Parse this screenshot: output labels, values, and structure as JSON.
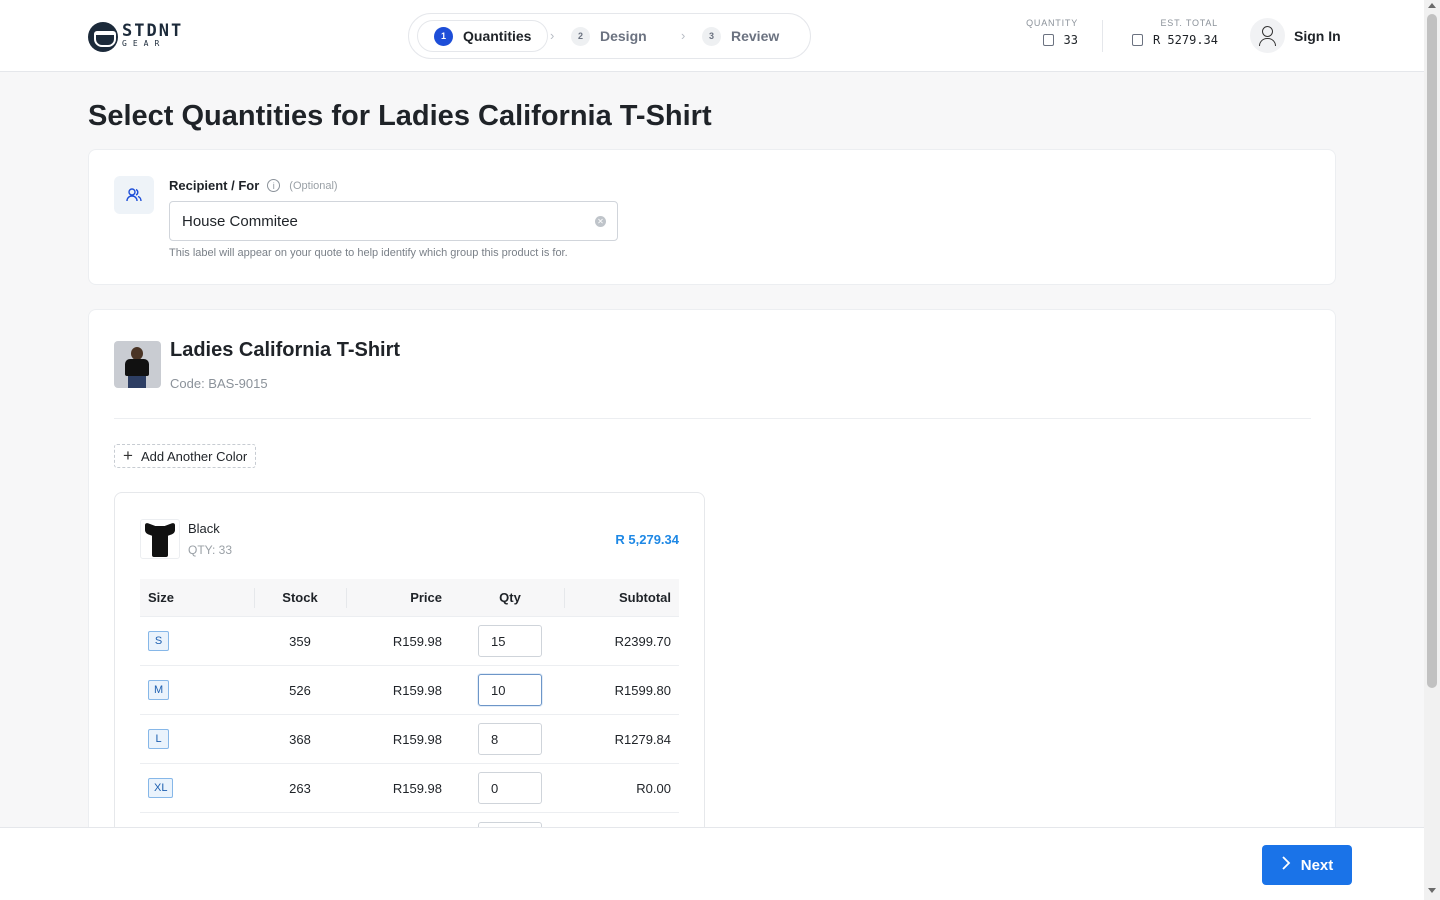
{
  "brand": {
    "name": "STDNT",
    "sub": "GEAR"
  },
  "stepper": {
    "steps": [
      {
        "num": "1",
        "label": "Quantities"
      },
      {
        "num": "2",
        "label": "Design"
      },
      {
        "num": "3",
        "label": "Review"
      }
    ],
    "separator": "›"
  },
  "header": {
    "quantity_label": "QUANTITY",
    "quantity_value": "33",
    "total_label": "EST. TOTAL",
    "total_value": "R 5279.34",
    "signin_label": "Sign In"
  },
  "page_title": "Select Quantities for Ladies California T-Shirt",
  "recipient": {
    "label": "Recipient / For",
    "info_glyph": "i",
    "optional": "(Optional)",
    "value": "House Commitee",
    "help": "This label will appear on your quote to help identify which group this product is for.",
    "icon": "users-icon"
  },
  "product": {
    "name": "Ladies California T-Shirt",
    "code": "Code: BAS-9015",
    "add_color_label": "Add Another Color"
  },
  "color_group": {
    "name": "Black",
    "qty": "QTY: 33",
    "total": "R 5,279.34",
    "columns": [
      "Size",
      "Stock",
      "Price",
      "Qty",
      "Subtotal"
    ],
    "rows": [
      {
        "size": "S",
        "stock": "359",
        "price": "R159.98",
        "qty": "15",
        "subtotal": "R2399.70"
      },
      {
        "size": "M",
        "stock": "526",
        "price": "R159.98",
        "qty": "10",
        "subtotal": "R1599.80"
      },
      {
        "size": "L",
        "stock": "368",
        "price": "R159.98",
        "qty": "8",
        "subtotal": "R1279.84"
      },
      {
        "size": "XL",
        "stock": "263",
        "price": "R159.98",
        "qty": "0",
        "subtotal": "R0.00"
      }
    ]
  },
  "footer": {
    "next_label": "Next"
  },
  "colors": {
    "accent": "#1a73e8",
    "step_active": "#1d4ed8",
    "price_blue": "#1e88e5"
  }
}
